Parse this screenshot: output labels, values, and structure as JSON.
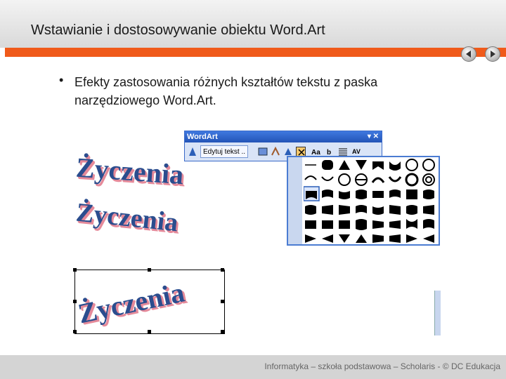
{
  "slide": {
    "title": "Wstawianie i dostosowywanie obiektu Word.Art",
    "bullet_marker": "•",
    "bullet_text": "Efekty zastosowania różnych kształtów tekstu z paska narzędziowego Word.Art.",
    "footer": "Informatyka – szkoła podstawowa – Scholaris - © DC Edukacja"
  },
  "wordart_samples": [
    "Życzenia",
    "Życzenia",
    "Życzenia"
  ],
  "toolbar": {
    "title": "WordArt",
    "edit_text_label": "Edytuj tekst ..",
    "controls": "▾ ✕"
  },
  "nav": {
    "prev_icon": "prev-arrow-icon",
    "next_icon": "next-arrow-icon"
  },
  "colors": {
    "accent": "#f05a1a",
    "wordart_fill": "#2b4d8e",
    "wordart_shadow": "#e58a9a",
    "toolbar_blue": "#2354b7"
  }
}
